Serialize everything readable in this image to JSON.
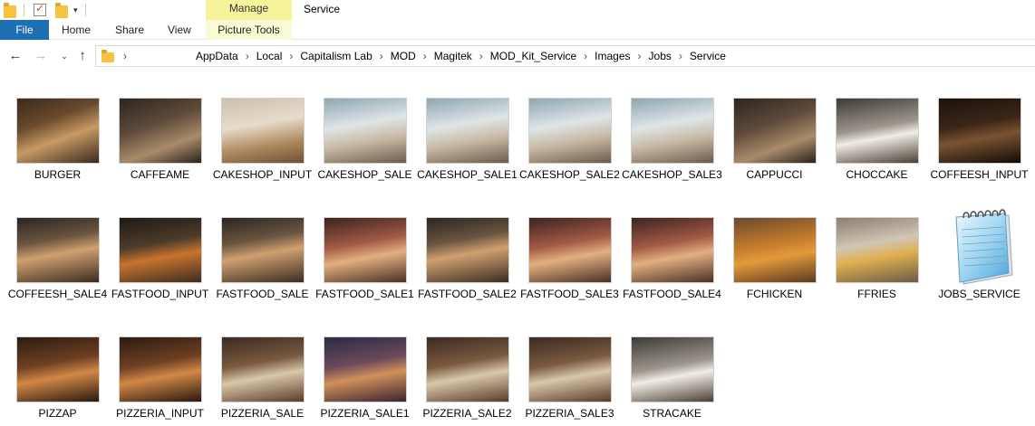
{
  "window": {
    "title": "Service",
    "context_tab": "Manage",
    "context_group": "Picture Tools"
  },
  "ribbon": {
    "tabs": [
      "File",
      "Home",
      "Share",
      "View"
    ]
  },
  "address": {
    "root_chevron": "›",
    "path": [
      "AppData",
      "Local",
      "Capitalism Lab",
      "MOD",
      "Magitek",
      "MOD_Kit_Service",
      "Images",
      "Jobs",
      "Service"
    ]
  },
  "files": [
    {
      "name": "BURGER",
      "kind": "image",
      "tone": "t-warm"
    },
    {
      "name": "CAFFEAME",
      "kind": "image",
      "tone": "t-cafe"
    },
    {
      "name": "CAKESHOP_INPUT",
      "kind": "image",
      "tone": "t-cake"
    },
    {
      "name": "CAKESHOP_SALE",
      "kind": "image",
      "tone": "t-shop"
    },
    {
      "name": "CAKESHOP_SALE1",
      "kind": "image",
      "tone": "t-shop"
    },
    {
      "name": "CAKESHOP_SALE2",
      "kind": "image",
      "tone": "t-shop"
    },
    {
      "name": "CAKESHOP_SALE3",
      "kind": "image",
      "tone": "t-shop"
    },
    {
      "name": "CAPPUCCI",
      "kind": "image",
      "tone": "t-cafe"
    },
    {
      "name": "CHOCCAKE",
      "kind": "image",
      "tone": "t-choc"
    },
    {
      "name": "COFFEESH_INPUT",
      "kind": "image",
      "tone": "t-coffee"
    },
    {
      "name": "COFFEESH_SALE4",
      "kind": "image",
      "tone": "t-fast"
    },
    {
      "name": "FASTFOOD_INPUT",
      "kind": "image",
      "tone": "t-food"
    },
    {
      "name": "FASTFOOD_SALE",
      "kind": "image",
      "tone": "t-fast"
    },
    {
      "name": "FASTFOOD_SALE1",
      "kind": "image",
      "tone": "t-red"
    },
    {
      "name": "FASTFOOD_SALE2",
      "kind": "image",
      "tone": "t-fast"
    },
    {
      "name": "FASTFOOD_SALE3",
      "kind": "image",
      "tone": "t-red"
    },
    {
      "name": "FASTFOOD_SALE4",
      "kind": "image",
      "tone": "t-red"
    },
    {
      "name": "FCHICKEN",
      "kind": "image",
      "tone": "t-chicken"
    },
    {
      "name": "FFRIES",
      "kind": "image",
      "tone": "t-fries"
    },
    {
      "name": "JOBS_SERVICE",
      "kind": "text",
      "icon": "notepad-icon"
    },
    {
      "name": "PIZZAP",
      "kind": "image",
      "tone": "t-pizza"
    },
    {
      "name": "PIZZERIA_INPUT",
      "kind": "image",
      "tone": "t-pizza"
    },
    {
      "name": "PIZZERIA_SALE",
      "kind": "image",
      "tone": "t-pizzeria"
    },
    {
      "name": "PIZZERIA_SALE1",
      "kind": "image",
      "tone": "t-hall"
    },
    {
      "name": "PIZZERIA_SALE2",
      "kind": "image",
      "tone": "t-pizzeria"
    },
    {
      "name": "PIZZERIA_SALE3",
      "kind": "image",
      "tone": "t-pizzeria"
    },
    {
      "name": "STRACAKE",
      "kind": "image",
      "tone": "t-choc"
    }
  ],
  "colors": {
    "file_tab": "#1f6fb5",
    "manage_tab": "#f6f49b",
    "folder": "#f5c242"
  }
}
